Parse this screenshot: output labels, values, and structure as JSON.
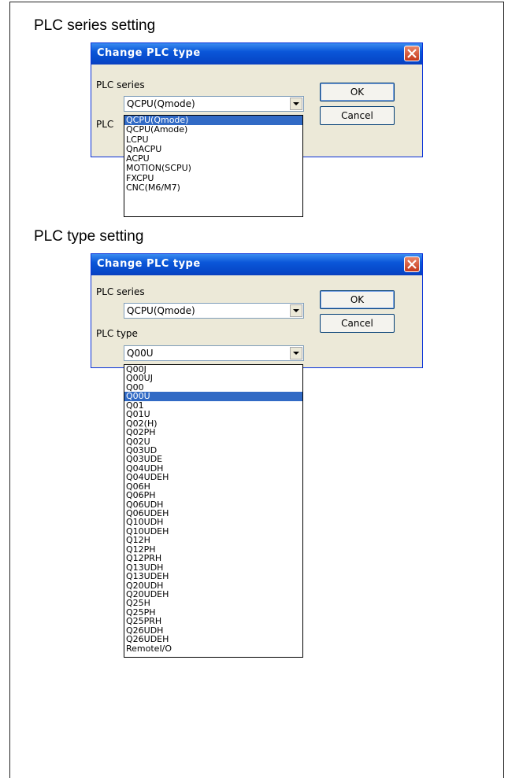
{
  "sections": {
    "series_title": "PLC series setting",
    "type_title": "PLC type setting"
  },
  "dialog1": {
    "title": "Change PLC type",
    "series_label": "PLC series",
    "series_value": "QCPU(Qmode)",
    "type_label": "PLC",
    "ok_label": "OK",
    "cancel_label": "Cancel",
    "series_options": [
      "QCPU(Qmode)",
      "QCPU(Amode)",
      "LCPU",
      "QnACPU",
      "ACPU",
      "MOTION(SCPU)",
      "FXCPU",
      "CNC(M6/M7)"
    ],
    "selected_index": 0
  },
  "dialog2": {
    "title": "Change PLC type",
    "series_label": "PLC series",
    "series_value": "QCPU(Qmode)",
    "type_label": "PLC type",
    "type_value": "Q00U",
    "ok_label": "OK",
    "cancel_label": "Cancel",
    "type_options": [
      "Q00J",
      "Q00UJ",
      "Q00",
      "Q00U",
      "Q01",
      "Q01U",
      "Q02(H)",
      "Q02PH",
      "Q02U",
      "Q03UD",
      "Q03UDE",
      "Q04UDH",
      "Q04UDEH",
      "Q06H",
      "Q06PH",
      "Q06UDH",
      "Q06UDEH",
      "Q10UDH",
      "Q10UDEH",
      "Q12H",
      "Q12PH",
      "Q12PRH",
      "Q13UDH",
      "Q13UDEH",
      "Q20UDH",
      "Q20UDEH",
      "Q25H",
      "Q25PH",
      "Q25PRH",
      "Q26UDH",
      "Q26UDEH",
      "RemoteI/O"
    ],
    "selected_index": 3
  },
  "colors": {
    "titlebar": "#0a56d8",
    "selection": "#316ac5",
    "dialog_bg": "#ece9d8"
  }
}
